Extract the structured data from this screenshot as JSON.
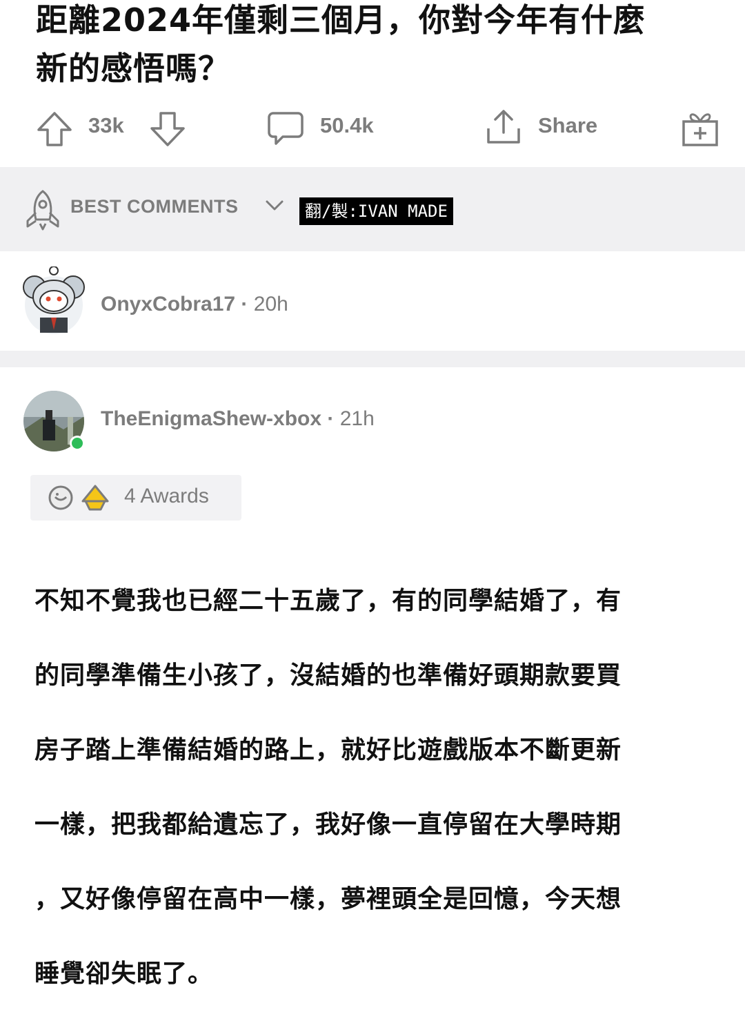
{
  "post": {
    "title_line1": "距離2024年僅剩三個月，你對今年有什麼",
    "title_line2": "新的感悟嗎？"
  },
  "actions": {
    "upvote_count": "33k",
    "comment_count": "50.4k",
    "share_label": "Share"
  },
  "sort": {
    "label": "BEST COMMENTS"
  },
  "watermark": "翻/製:IVAN MADE",
  "comments": [
    {
      "username": "OnyxCobra17",
      "separator": "·",
      "age": "20h"
    },
    {
      "username": "TheEnigmaShew-xbox",
      "separator": "·",
      "age": "21h",
      "awards_label": "4 Awards",
      "online": true,
      "body_lines": [
        "不知不覺我也已經二十五歲了，有的同學結婚了，有",
        "的同學準備生小孩了，沒結婚的也準備好頭期款要買",
        "房子踏上準備結婚的路上，就好比遊戲版本不斷更新",
        "一樣，把我都給遺忘了，我好像一直停留在大學時期",
        "，又好像停留在高中一樣，夢裡頭全是回憶，今天想",
        "睡覺卻失眠了。"
      ]
    }
  ],
  "icons": {
    "upvote": "upvote-arrow-icon",
    "downvote": "downvote-arrow-icon",
    "comment": "comment-bubble-icon",
    "share": "share-icon",
    "award": "gift-award-icon",
    "sort": "rocket-icon"
  },
  "colors": {
    "muted": "#7c7c7c",
    "band": "#f0f0f2",
    "online": "#2ebd59"
  }
}
